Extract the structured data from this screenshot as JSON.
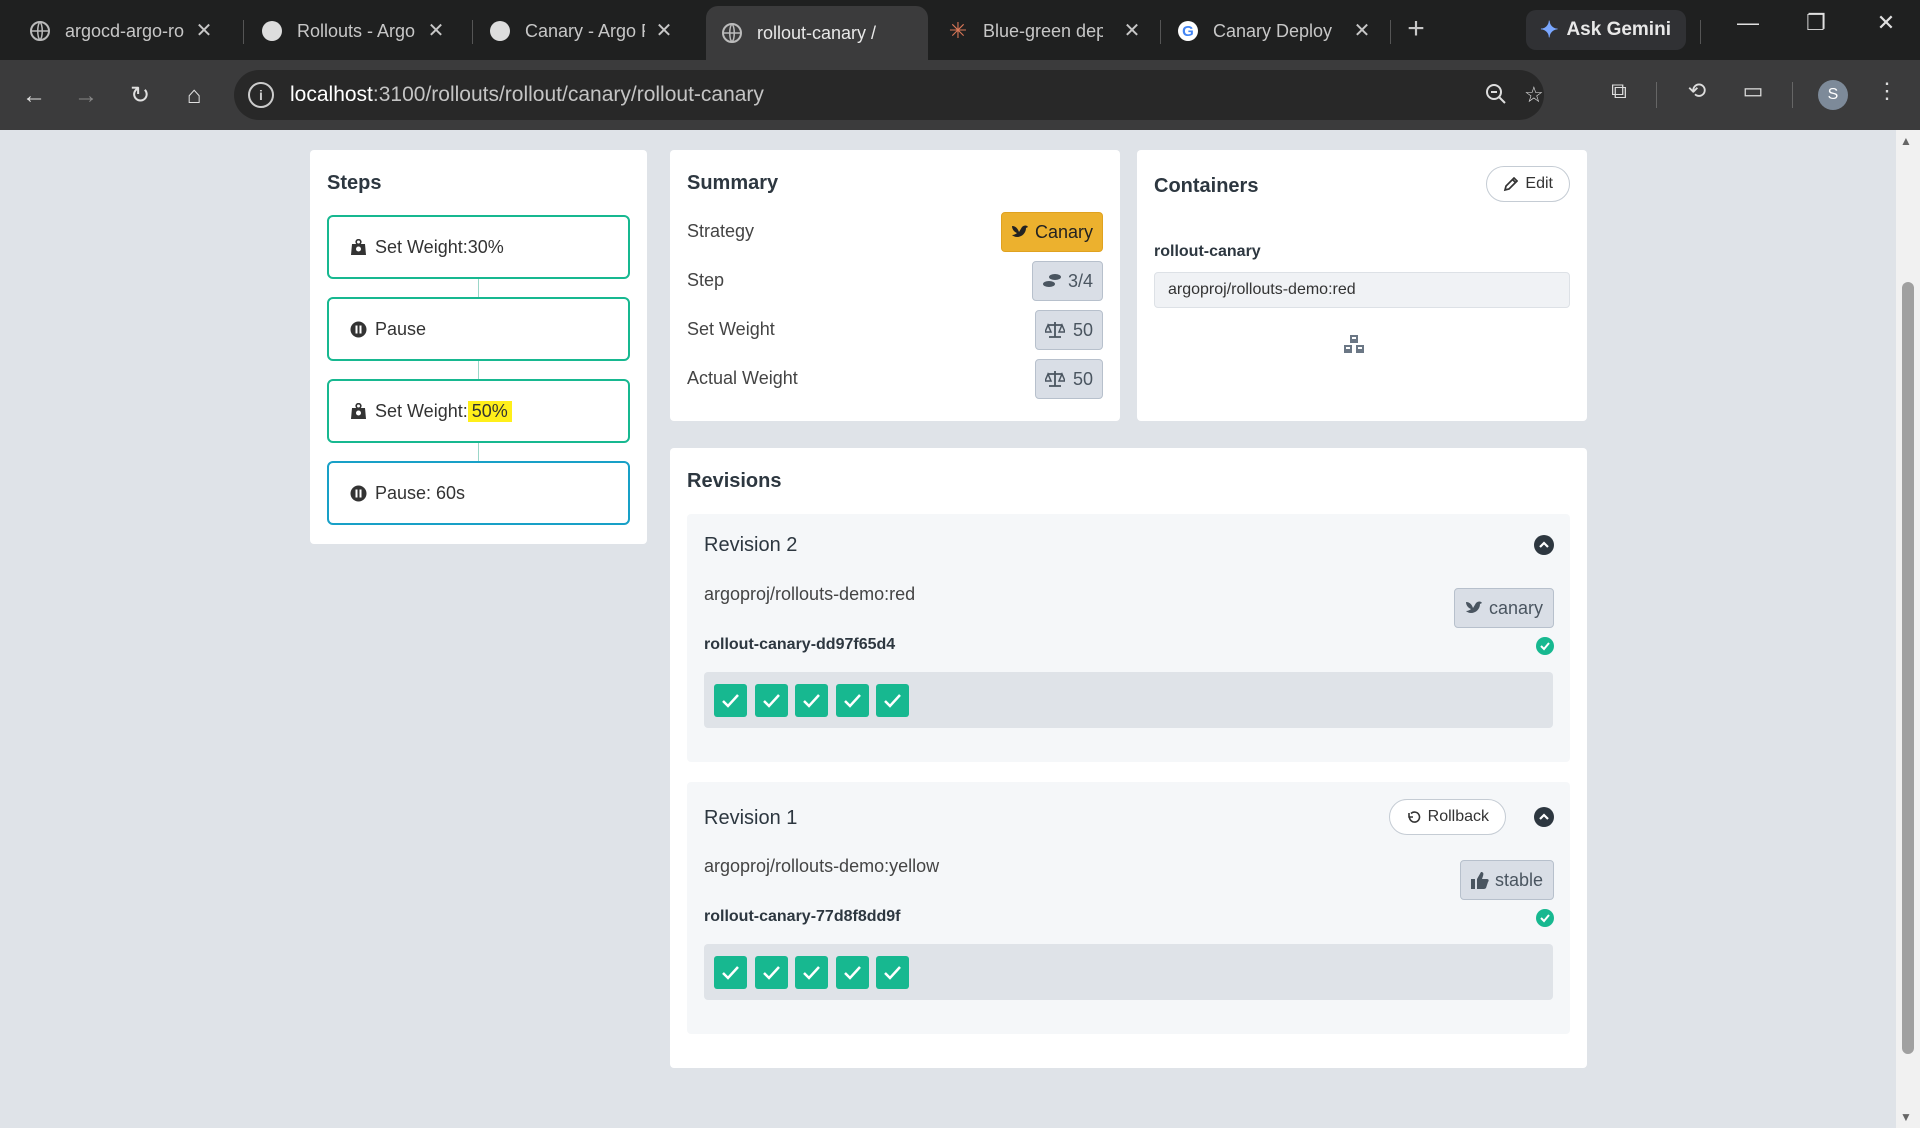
{
  "browser": {
    "tabs": [
      {
        "title": "argocd-argo-rollouts"
      },
      {
        "title": "Rollouts - Argo Rollouts"
      },
      {
        "title": "Canary - Argo Rollouts"
      },
      {
        "title": "rollout-canary / Rollouts"
      },
      {
        "title": "Blue-green deployment"
      },
      {
        "title": "Canary Deployment"
      }
    ],
    "active_tab": 3,
    "new_tab_symbol": "+",
    "gemini_label": "Ask Gemini",
    "url_host": "localhost",
    "url_rest": ":3100/rollouts/rollout/canary/rollout-canary",
    "profile_initial": "S"
  },
  "steps": {
    "title": "Steps",
    "items": [
      {
        "label": "Set Weight: ",
        "value": "30%",
        "kind": "weight"
      },
      {
        "label": "Pause",
        "value": "",
        "kind": "pause"
      },
      {
        "label": "Set Weight: ",
        "value": "50%",
        "kind": "weight"
      },
      {
        "label": "Pause: 60s",
        "value": "",
        "kind": "pause"
      }
    ]
  },
  "summary": {
    "title": "Summary",
    "strategy_label": "Strategy",
    "strategy_value": "Canary",
    "step_label": "Step",
    "step_value": "3/4",
    "set_weight_label": "Set Weight",
    "set_weight_value": "50",
    "actual_weight_label": "Actual Weight",
    "actual_weight_value": "50"
  },
  "containers": {
    "title": "Containers",
    "edit_label": "Edit",
    "name": "rollout-canary",
    "image": "argoproj/rollouts-demo:red"
  },
  "revisions": {
    "title": "Revisions",
    "items": [
      {
        "title": "Revision 2",
        "image": "argoproj/rollouts-demo:red",
        "tag": "canary",
        "replicaset": "rollout-canary-dd97f65d4",
        "pods": 5
      },
      {
        "title": "Revision 1",
        "image": "argoproj/rollouts-demo:yellow",
        "tag": "stable",
        "replicaset": "rollout-canary-77d8f8dd9f",
        "rollback_label": "Rollback",
        "pods": 5
      }
    ]
  },
  "colors": {
    "healthy": "#17b890",
    "current_step": "#18a0c7",
    "canary_badge": "#ecb12e",
    "highlight": "#ffef1a"
  }
}
